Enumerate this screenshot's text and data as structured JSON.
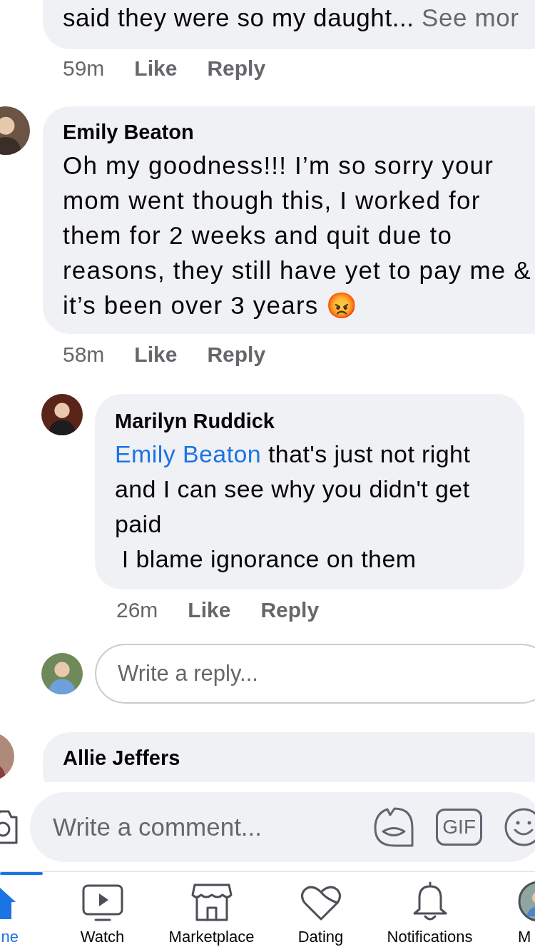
{
  "partial_comment": {
    "text": "said they were so my daught...",
    "see_more": "See mor",
    "time": "59m",
    "like": "Like",
    "reply": "Reply"
  },
  "comment": {
    "author": "Emily Beaton",
    "text": "Oh my goodness!!! I’m so sorry your mom went though this, I worked for them for 2 weeks and quit due to reasons, they still have yet to pay me & it’s been over 3 years 😡",
    "time": "58m",
    "like": "Like",
    "reply": "Reply"
  },
  "reply": {
    "author": "Marilyn Ruddick",
    "mention": "Emily Beaton",
    "text": " that's just not right and I can see why you didn't get paid\n I blame ignorance on them",
    "time": "26m",
    "like": "Like",
    "reply": "Reply"
  },
  "reply_box": {
    "placeholder": "Write a reply..."
  },
  "next_comment": {
    "author": "Allie Jeffers"
  },
  "composer": {
    "placeholder": "Write a comment...",
    "gif_label": "GIF"
  },
  "tabs": [
    {
      "kind": "home",
      "label": "ne",
      "selected": true
    },
    {
      "kind": "watch",
      "label": "Watch",
      "selected": false
    },
    {
      "kind": "marketplace",
      "label": "Marketplace",
      "selected": false
    },
    {
      "kind": "dating",
      "label": "Dating",
      "selected": false
    },
    {
      "kind": "notifications",
      "label": "Notifications",
      "selected": false
    },
    {
      "kind": "menu",
      "label": "M",
      "selected": false
    }
  ]
}
